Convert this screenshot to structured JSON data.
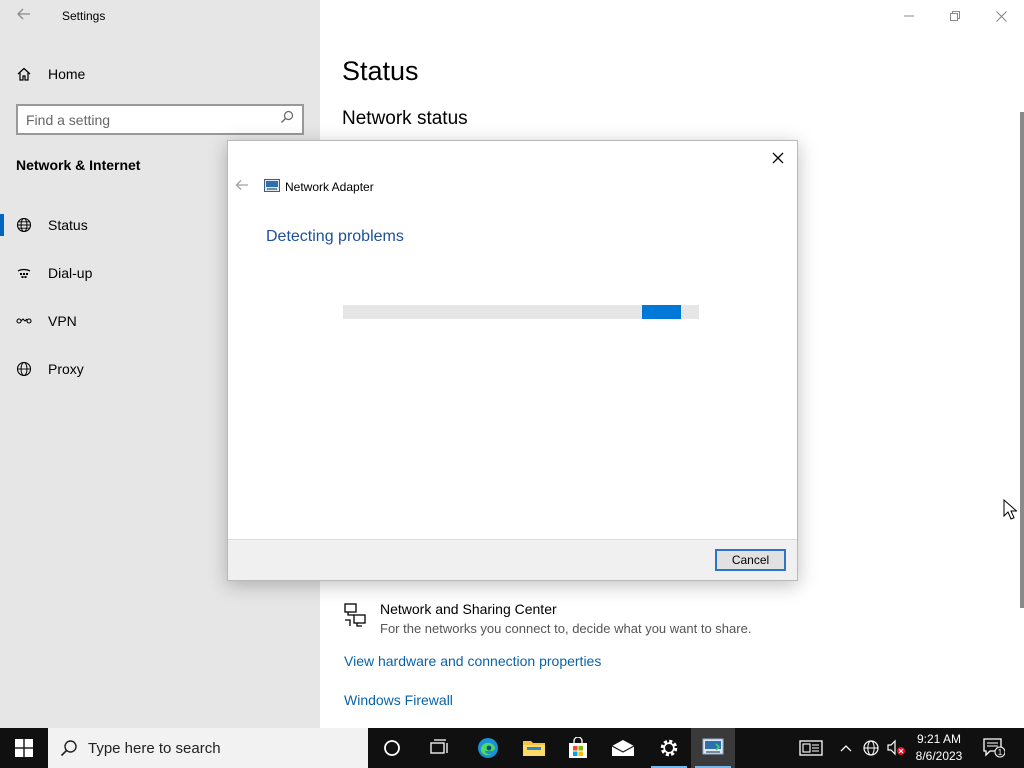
{
  "settings": {
    "app_title": "Settings",
    "home_label": "Home",
    "search_placeholder": "Find a setting",
    "section_title": "Network & Internet",
    "nav": [
      {
        "label": "Status",
        "icon": "globe-network-icon",
        "active": true
      },
      {
        "label": "Dial-up",
        "icon": "dial-up-icon",
        "active": false
      },
      {
        "label": "VPN",
        "icon": "vpn-icon",
        "active": false
      },
      {
        "label": "Proxy",
        "icon": "globe-icon",
        "active": false
      }
    ],
    "page_title": "Status",
    "sub_title": "Network status",
    "sharing_center": {
      "title": "Network and Sharing Center",
      "description": "For the networks you connect to, decide what you want to share."
    },
    "links": {
      "hardware": "View hardware and connection properties",
      "firewall": "Windows Firewall"
    }
  },
  "dialog": {
    "app_name": "Network Adapter",
    "heading": "Detecting problems",
    "progress": {
      "indeterminate": true,
      "chunk_start": 0.84,
      "chunk_width": 0.11
    },
    "cancel_label": "Cancel"
  },
  "taskbar": {
    "search_placeholder": "Type here to search",
    "time": "9:21 AM",
    "date": "8/6/2023",
    "notification_count": "1"
  },
  "colors": {
    "accent": "#0078d7",
    "link": "#0a63a8",
    "heading_blue": "#1e4f9c",
    "sidebar_bg": "#e6e6e6",
    "taskbar_bg": "#101010"
  }
}
